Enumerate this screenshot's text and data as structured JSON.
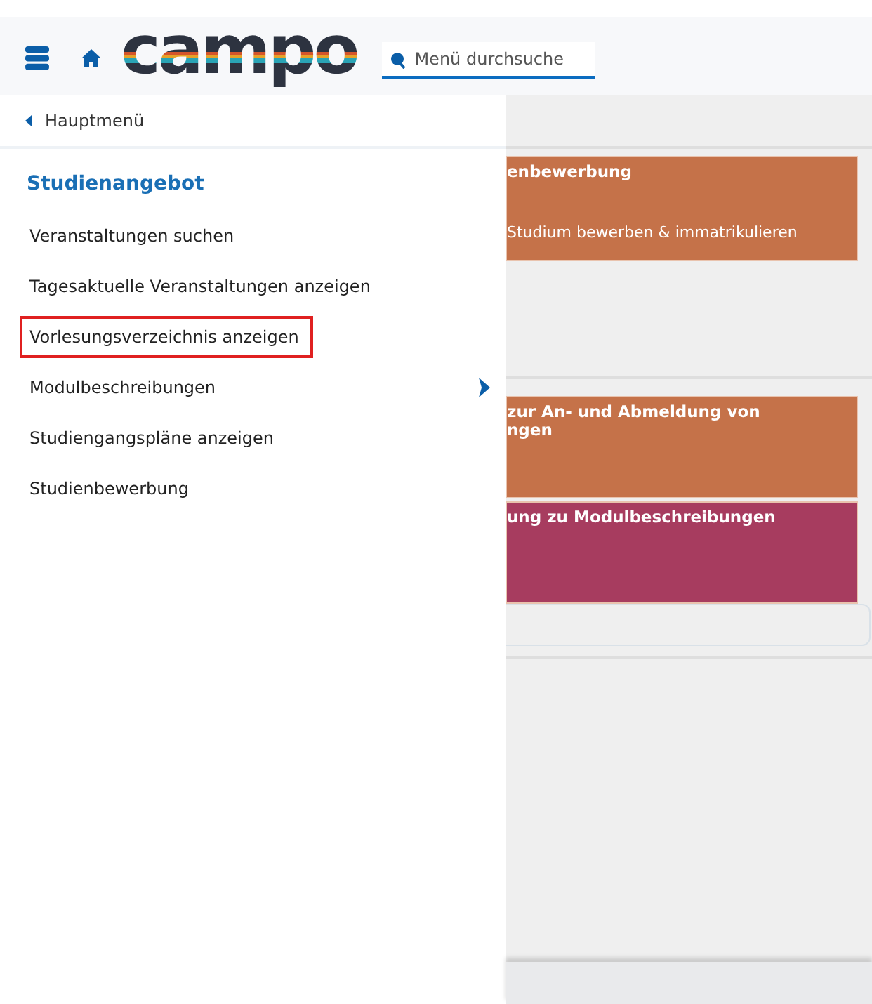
{
  "header": {
    "logo": "campo",
    "search": {
      "placeholder": "Menü durchsuche"
    }
  },
  "sidebar": {
    "back_label": "Hauptmenü",
    "title": "Studienangebot",
    "items": [
      {
        "label": "Veranstaltungen suchen",
        "highlighted": false,
        "has_submenu": false
      },
      {
        "label": "Tagesaktuelle Veranstaltungen anzeigen",
        "highlighted": false,
        "has_submenu": false
      },
      {
        "label": "Vorlesungsverzeichnis anzeigen",
        "highlighted": true,
        "has_submenu": false
      },
      {
        "label": "Modulbeschreibungen",
        "highlighted": false,
        "has_submenu": true
      },
      {
        "label": "Studiengangspläne anzeigen",
        "highlighted": false,
        "has_submenu": false
      },
      {
        "label": "Studienbewerbung",
        "highlighted": false,
        "has_submenu": false
      }
    ]
  },
  "content": {
    "groups": [
      {
        "tiles": [
          {
            "title": "enbewerbung",
            "subtitle": "Studium bewerben & immatrikulieren",
            "color": "#c57249"
          }
        ]
      },
      {
        "tiles": [
          {
            "title": "zur An- und Abmeldung von\nngen",
            "color": "#c57249"
          },
          {
            "title": "ung zu Modulbeschreibungen",
            "color": "#a73c5f"
          }
        ]
      }
    ]
  }
}
